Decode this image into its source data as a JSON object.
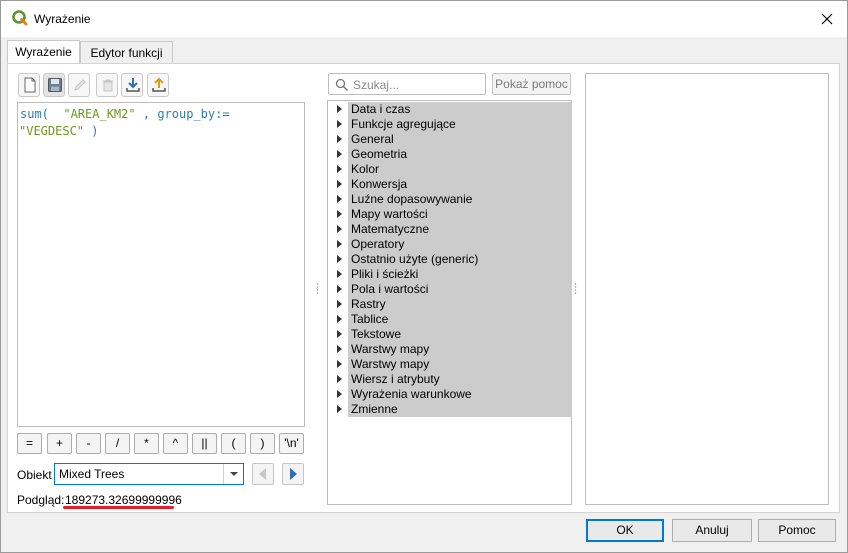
{
  "window": {
    "title": "Wyrażenie",
    "close_icon": "close-icon",
    "app_icon": "qgis-logo-icon"
  },
  "tabs": [
    {
      "label": "Wyrażenie",
      "active": true
    },
    {
      "label": "Edytor funkcji",
      "active": false
    }
  ],
  "toolbar": {
    "buttons": [
      {
        "name": "new-file-icon"
      },
      {
        "name": "save-icon"
      },
      {
        "name": "edit-icon"
      },
      {
        "name": "delete-icon"
      },
      {
        "name": "import-icon"
      },
      {
        "name": "export-icon"
      }
    ]
  },
  "editor": {
    "tokens": {
      "fn": "sum(",
      "field1": "\"AREA_KM2\"",
      "comma": ",",
      "param": "group_by:=",
      "field2": "\"VEGDESC\"",
      "close": ")"
    }
  },
  "operators": [
    "=",
    "+",
    "-",
    "/",
    "*",
    "^",
    "||",
    "(",
    ")",
    "'\\n'"
  ],
  "object": {
    "label": "Obiekt",
    "value": "Mixed Trees"
  },
  "preview": {
    "label": "Podgląd:",
    "value": "189273.32699999996"
  },
  "search": {
    "placeholder": "Szukaj...",
    "help_button": "Pokaż pomoc"
  },
  "function_groups": [
    "Data i czas",
    "Funkcje agregujące",
    "General",
    "Geometria",
    "Kolor",
    "Konwersja",
    "Luźne dopasowywanie",
    "Mapy wartości",
    "Matematyczne",
    "Operatory",
    "Ostatnio użyte (generic)",
    "Pliki i ścieżki",
    "Pola i wartości",
    "Rastry",
    "Tablice",
    "Tekstowe",
    "Warstwy mapy",
    "Warstwy mapy",
    "Wiersz i atrybuty",
    "Wyrażenia warunkowe",
    "Zmienne"
  ],
  "buttons": {
    "ok": "OK",
    "cancel": "Anuluj",
    "help": "Pomoc"
  },
  "colors": {
    "accent": "#0078d7",
    "highlight": "#e0202a",
    "selection": "#cccccc",
    "function_color": "#2e7db3",
    "string_color": "#6a9a1a"
  }
}
